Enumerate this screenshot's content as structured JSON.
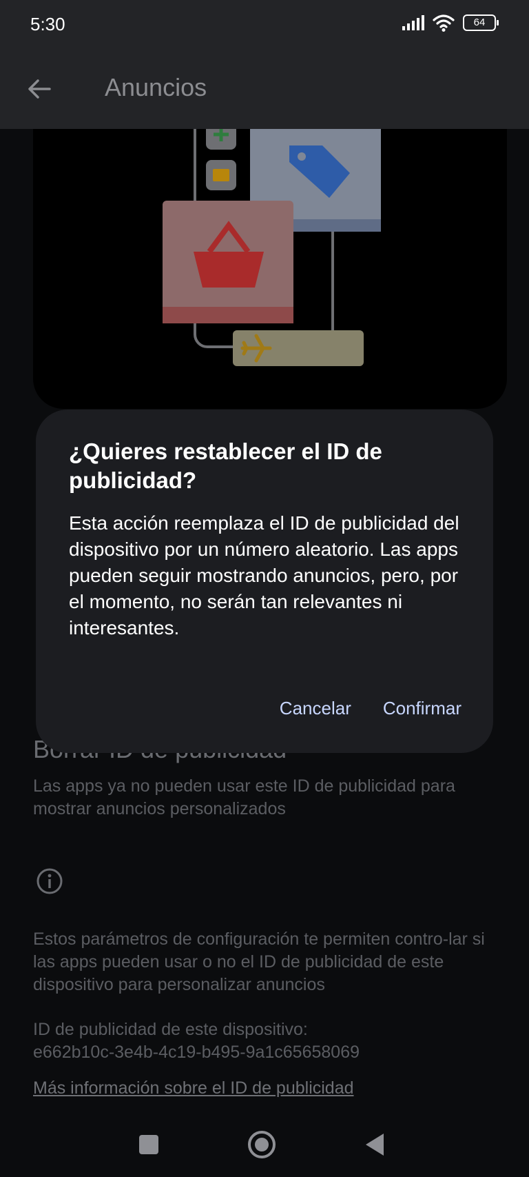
{
  "status_bar": {
    "time": "5:30",
    "battery": "64"
  },
  "app_bar": {
    "title": "Anuncios"
  },
  "background": {
    "delete_title": "Borrar ID de publicidad",
    "delete_desc": "Las apps ya no pueden usar este ID de publicidad para mostrar anuncios personalizados",
    "info_text": "Estos parámetros de configuración te permiten contro-lar si las apps pueden usar o no el ID de publicidad de este dispositivo para personalizar anuncios",
    "device_id_label": "ID de publicidad de este dispositivo:",
    "device_id_value": "e662b10c-3e4b-4c19-b495-9a1c65658069",
    "learn_more_link": "Más información sobre el ID de publicidad"
  },
  "dialog": {
    "title": "¿Quieres restablecer el ID de publicidad?",
    "body": "Esta acción reemplaza el ID de publicidad del dispositivo por un número aleatorio. Las apps pueden seguir mostrando anuncios, pero, por el momento, no serán tan relevantes ni interesantes.",
    "cancel_label": "Cancelar",
    "confirm_label": "Confirmar"
  },
  "icons": {
    "signal": "signal-icon",
    "wifi": "wifi-icon",
    "battery": "battery-icon",
    "back": "arrow-back-icon",
    "info": "info-icon",
    "nav_recents": "square-icon",
    "nav_home": "circle-icon",
    "nav_back": "triangle-back-icon"
  },
  "colors": {
    "accent": "#c8d7ff",
    "dialog_bg": "#1c1d21",
    "screen_bg": "#0b0c0e"
  }
}
